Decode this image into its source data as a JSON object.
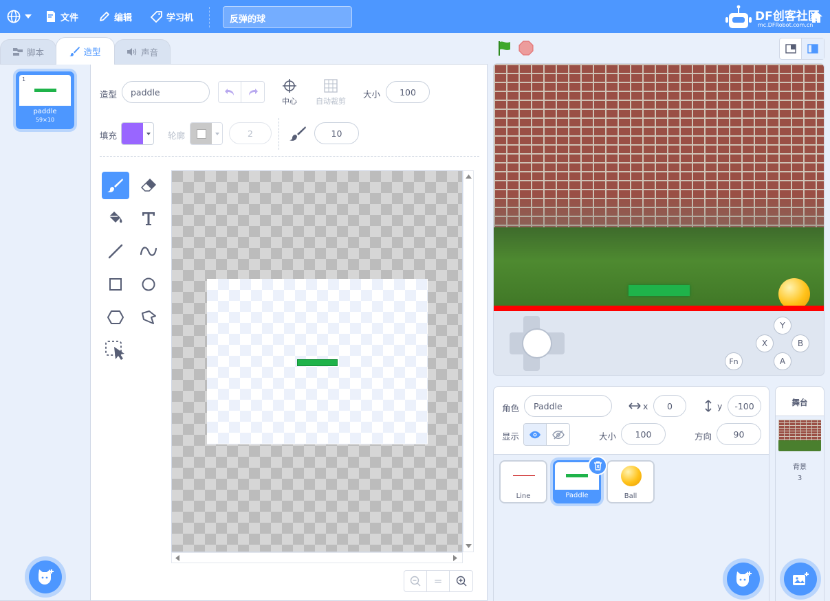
{
  "menu": {
    "file": "文件",
    "edit": "编辑",
    "learn": "学习机",
    "project_title": "反弹的球"
  },
  "brand": {
    "logo": "DF创客社区",
    "url": "mc.DFRobot.com.cn"
  },
  "tabs": [
    {
      "label": "脚本"
    },
    {
      "label": "造型"
    },
    {
      "label": "声音"
    }
  ],
  "costume_list": [
    {
      "index": "1",
      "name": "paddle",
      "size": "59×10"
    }
  ],
  "editor": {
    "costume_label": "造型",
    "costume_name": "paddle",
    "center_label": "中心",
    "autocrop_label": "自动裁剪",
    "size_label": "大小",
    "size_value": "100",
    "fill_label": "填充",
    "fill_color": "#9966ff",
    "outline_label": "轮廓",
    "outline_width": "2",
    "brush_size": "10"
  },
  "zoom": {
    "reset": "="
  },
  "sprite_info": {
    "sprite_label": "角色",
    "sprite_name": "Paddle",
    "x_label": "x",
    "x_value": "0",
    "y_label": "y",
    "y_value": "-100",
    "show_label": "显示",
    "size_label": "大小",
    "size_value": "100",
    "direction_label": "方向",
    "direction_value": "90"
  },
  "sprites": [
    {
      "name": "Line"
    },
    {
      "name": "Paddle"
    },
    {
      "name": "Ball"
    }
  ],
  "stage_panel": {
    "title": "舞台",
    "backdrop_label": "背景",
    "backdrop_count": "3"
  },
  "gamepad": {
    "y": "Y",
    "x": "X",
    "b": "B",
    "a": "A",
    "fn": "Fn"
  },
  "colors": {
    "accent": "#4d97ff",
    "paddle": "#1fb34a",
    "ground_line": "#ff0000",
    "ball": "#ffc21a"
  }
}
